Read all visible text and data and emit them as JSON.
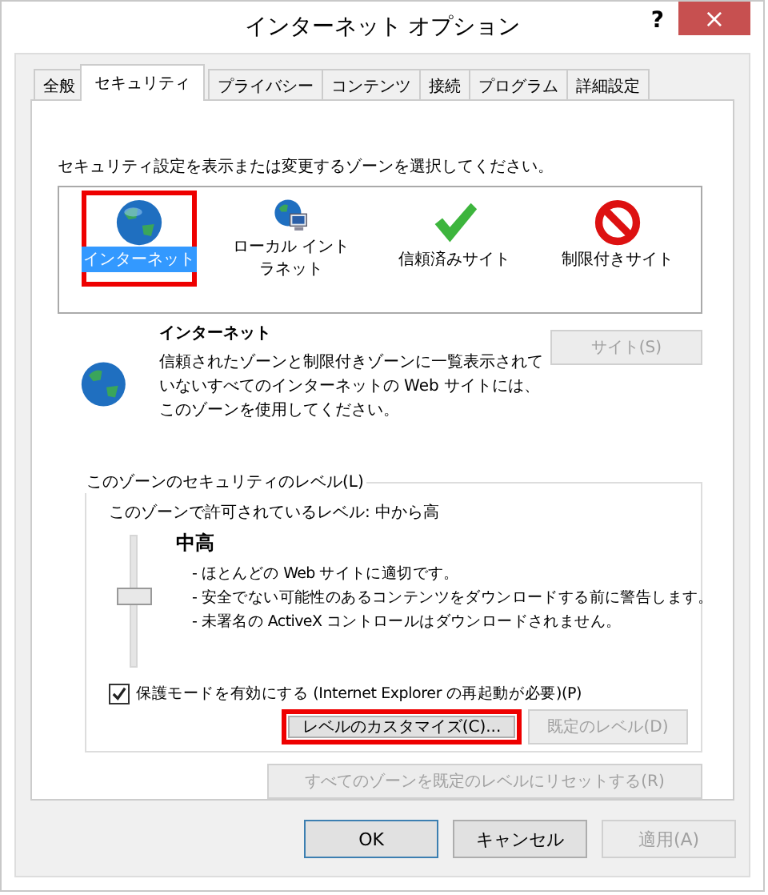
{
  "window": {
    "title": "インターネット オプション",
    "help": "?",
    "close": "×"
  },
  "tabs": [
    {
      "label": "全般",
      "selected": false
    },
    {
      "label": "セキュリティ",
      "selected": true
    },
    {
      "label": "プライバシー",
      "selected": false
    },
    {
      "label": "コンテンツ",
      "selected": false
    },
    {
      "label": "接続",
      "selected": false
    },
    {
      "label": "プログラム",
      "selected": false
    },
    {
      "label": "詳細設定",
      "selected": false
    }
  ],
  "zone_prompt": "セキュリティ設定を表示または変更するゾーンを選択してください。",
  "zones": [
    {
      "label": "インターネット",
      "kind": "globe",
      "selected": true,
      "highlighted": true
    },
    {
      "label": "ローカル イントラネット",
      "kind": "intranet",
      "selected": false,
      "highlighted": false
    },
    {
      "label": "信頼済みサイト",
      "kind": "check",
      "selected": false,
      "highlighted": false
    },
    {
      "label": "制限付きサイト",
      "kind": "forbidden",
      "selected": false,
      "highlighted": false
    }
  ],
  "zone_info": {
    "title": "インターネット",
    "description": "信頼されたゾーンと制限付きゾーンに一覧表示されていないすべてのインターネットの Web サイトには、このゾーンを使用してください。",
    "sites_button": {
      "label": "サイト(S)",
      "disabled": true
    }
  },
  "security_level": {
    "legend": "このゾーンのセキュリティのレベル(L)",
    "allowed": "このゾーンで許可されているレベル: 中から高",
    "level": 0.5,
    "name": "中高",
    "bullets": [
      "- ほとんどの Web サイトに適切です。",
      "- 安全でない可能性のあるコンテンツをダウンロードする前に警告します。",
      "- 未署名の ActiveX コントロールはダウンロードされません。"
    ],
    "protected_mode": {
      "label": "保護モードを有効にする (Internet Explorer の再起動が必要)(P)",
      "checked": true
    },
    "buttons": [
      {
        "label": "レベルのカスタマイズ(C)...",
        "disabled": false,
        "highlighted": true
      },
      {
        "label": "既定のレベル(D)",
        "disabled": true,
        "highlighted": false
      }
    ]
  },
  "reset_button": {
    "label": "すべてのゾーンを既定のレベルにリセットする(R)",
    "disabled": true
  },
  "dialog_buttons": [
    {
      "label": "OK",
      "disabled": false,
      "default": true
    },
    {
      "label": "キャンセル",
      "disabled": false,
      "default": false
    },
    {
      "label": "適用(A)",
      "disabled": true,
      "default": false
    }
  ]
}
